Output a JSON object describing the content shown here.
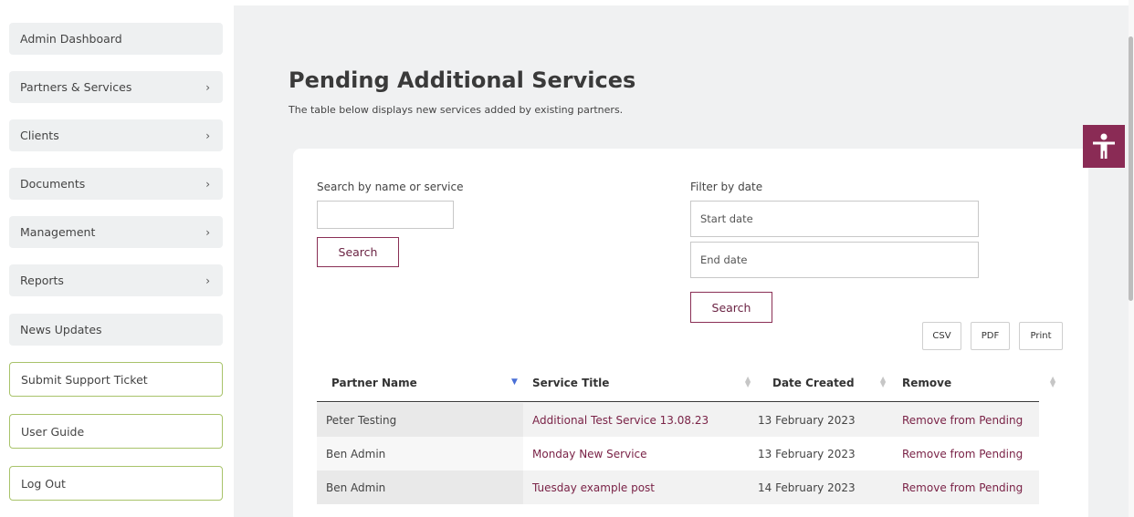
{
  "sidebar": {
    "items": [
      {
        "label": "Admin Dashboard",
        "chevron": false
      },
      {
        "label": "Partners & Services",
        "chevron": true
      },
      {
        "label": "Clients",
        "chevron": true
      },
      {
        "label": "Documents",
        "chevron": true
      },
      {
        "label": "Management",
        "chevron": true
      },
      {
        "label": "Reports",
        "chevron": true
      },
      {
        "label": "News Updates",
        "chevron": false
      }
    ],
    "actions": [
      {
        "label": "Submit Support Ticket"
      },
      {
        "label": "User Guide"
      },
      {
        "label": "Log Out"
      }
    ],
    "chevron_glyph": "›"
  },
  "page": {
    "title": "Pending Additional Services",
    "subtitle": "The table below displays new services added by existing partners."
  },
  "search": {
    "label": "Search by name or service",
    "value": "",
    "button": "Search"
  },
  "date_filter": {
    "label": "Filter by date",
    "start_placeholder": "Start date",
    "end_placeholder": "End date",
    "button": "Search"
  },
  "export": {
    "csv": "CSV",
    "pdf": "PDF",
    "print": "Print"
  },
  "table": {
    "headers": [
      "Partner Name",
      "Service Title",
      "Date Created",
      "Remove"
    ],
    "rows": [
      {
        "partner": "Peter Testing",
        "service": "Additional Test Service 13.08.23",
        "date": "13 February 2023",
        "remove": "Remove from Pending"
      },
      {
        "partner": "Ben Admin",
        "service": "Monday New Service",
        "date": "13 February 2023",
        "remove": "Remove from Pending"
      },
      {
        "partner": "Ben Admin",
        "service": "Tuesday example post",
        "date": "14 February 2023",
        "remove": "Remove from Pending"
      }
    ]
  },
  "colors": {
    "accent": "#8a2b55",
    "outline_green": "#a8c36a",
    "sort_active": "#4a6fd6"
  },
  "icons": {
    "accessibility": "accessibility-icon",
    "sort": "sort-icon",
    "chevron": "chevron-right-icon"
  }
}
